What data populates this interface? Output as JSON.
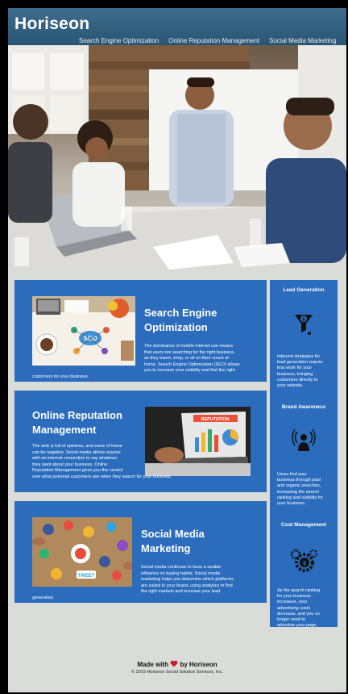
{
  "header": {
    "logo": "Horiseon",
    "nav": [
      "Search Engine Optimization",
      "Online Reputation Management",
      "Social Media Marketing"
    ]
  },
  "cards": [
    {
      "title_line1": "Search Engine",
      "title_line2": "Optimization",
      "body_lines": [
        "The dominance of mobile internet use means",
        "that users are searching for the right business",
        "as they travel, shop, or sit on their couch at",
        "home. Search Engine Optimization (SEO) allows",
        "you to increase your visibility and find the right",
        "customers for your business."
      ]
    },
    {
      "title_line1": "Online Reputation",
      "title_line2": "Management",
      "body_lines": [
        "The web is full of opinions, and some of these",
        "can be negative. Social media allows anyone",
        "with an internet connection to say whatever",
        "they want about your business. Online",
        "Reputation Management gives you the control",
        "over what potential customers see when they search for your business."
      ]
    },
    {
      "title_line1": "Social Media",
      "title_line2": "Marketing",
      "body_lines": [
        "Social media continues to have a sizable",
        "influence on buying habits. Social media",
        "marketing helps you determine which platforms",
        "are suited to your brand, using analytics to find",
        "the right markets and increase your lead",
        "generation."
      ]
    }
  ],
  "aside": [
    {
      "heading": "Lead Generation",
      "lines": [
        "Inbound strategies for",
        "lead generation require",
        "less work for your",
        "business, bringing",
        "customers directly to",
        "your website."
      ]
    },
    {
      "heading": "Brand Awareness",
      "lines": [
        "Users find your",
        "business through paid",
        "and organic searches,",
        "increasing the search",
        "ranking and visibility for",
        "your business."
      ]
    },
    {
      "heading": "Cost Management",
      "lines": [
        "As the search ranking",
        "for your business",
        "increases, your",
        "advertising costs",
        "decrease, and you no",
        "longer need to",
        "advertise your page."
      ]
    }
  ],
  "image_labels": {
    "seo": "SEO",
    "reputation": "REPUTATION",
    "tweet": "TWEET"
  },
  "footer": {
    "made_prefix": "Made with",
    "made_suffix": "by Horiseon",
    "copyright": "© 2019 Horiseon Social Solution Services, Inc."
  },
  "colors": {
    "header": "#2a5676",
    "card": "#2b6cbd",
    "page_bg": "#d9dcd9",
    "heart": "#cc1f2a"
  },
  "icons": [
    "heart-icon",
    "funnel-money-icon",
    "broadcast-person-icon",
    "gears-money-icon"
  ]
}
